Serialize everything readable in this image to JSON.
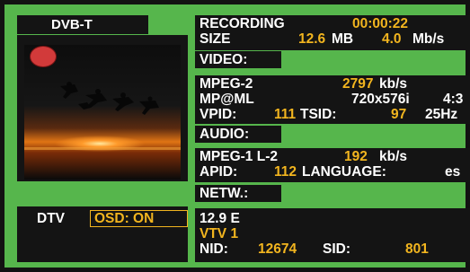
{
  "left": {
    "source_label": "DVB-T",
    "mode_label": "DTV",
    "osd_label": "OSD: ON"
  },
  "recording": {
    "label": "RECORDING",
    "time": "00:00:22",
    "size_label": "SIZE",
    "size_value": "12.6",
    "size_unit": "MB",
    "rate_value": "4.0",
    "rate_unit": "Mb/s"
  },
  "video": {
    "header": "VIDEO:",
    "codec": "MPEG-2",
    "bitrate": "2797",
    "bitrate_unit": "kb/s",
    "profile": "MP@ML",
    "resolution": "720x576i",
    "aspect": "4:3",
    "vpid_label": "VPID:",
    "vpid": "111",
    "tsid_label": "TSID:",
    "tsid": "97",
    "freq": "25Hz"
  },
  "audio": {
    "header": "AUDIO:",
    "codec": "MPEG-1 L-2",
    "bitrate": "192",
    "bitrate_unit": "kb/s",
    "apid_label": "APID:",
    "apid": "112",
    "language_label": "LANGUAGE:",
    "language": "es"
  },
  "network": {
    "header": "NETW.:",
    "position": "12.9 E",
    "channel": "VTV 1",
    "nid_label": "NID:",
    "nid": "12674",
    "sid_label": "SID:",
    "sid": "801"
  },
  "colors": {
    "frame_green": "#56b64c",
    "panel_black": "#141414",
    "value_yellow": "#f2b51f",
    "text_white": "#ffffff"
  }
}
